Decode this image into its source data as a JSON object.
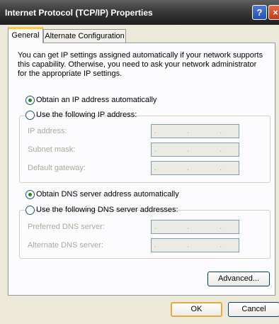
{
  "window": {
    "title": "Internet Protocol (TCP/IP) Properties"
  },
  "titlebar": {
    "help_label": "?",
    "close_label": "×"
  },
  "tabs": [
    {
      "label": "General",
      "selected": true
    },
    {
      "label": "Alternate Configuration",
      "selected": false
    }
  ],
  "description": "You can get IP settings assigned automatically if your network supports this capability. Otherwise, you need to ask your network administrator for the appropriate IP settings.",
  "ip": {
    "auto_label": "Obtain an IP address automatically",
    "auto_checked": true,
    "manual_label": "Use the following IP address:",
    "manual_checked": false,
    "fields": [
      {
        "label": "IP address:",
        "value": ". . ."
      },
      {
        "label": "Subnet mask:",
        "value": ". . ."
      },
      {
        "label": "Default gateway:",
        "value": ". . ."
      }
    ]
  },
  "dns": {
    "auto_label": "Obtain DNS server address automatically",
    "auto_checked": true,
    "manual_label": "Use the following DNS server addresses:",
    "manual_checked": false,
    "fields": [
      {
        "label": "Preferred DNS server:",
        "value": ". . ."
      },
      {
        "label": "Alternate DNS server:",
        "value": ". . ."
      }
    ]
  },
  "buttons": {
    "advanced": "Advanced...",
    "ok": "OK",
    "cancel": "Cancel"
  }
}
